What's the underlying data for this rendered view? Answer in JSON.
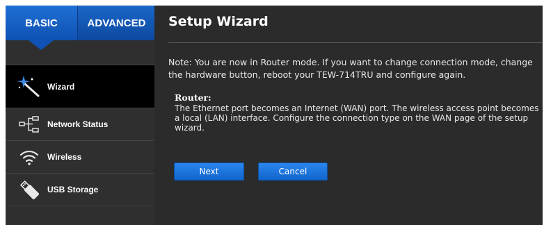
{
  "tabs": {
    "basic": "BASIC",
    "advanced": "ADVANCED"
  },
  "sidebar": {
    "items": [
      {
        "label": "Wizard",
        "icon": "wand-icon"
      },
      {
        "label": "Network Status",
        "icon": "network-icon"
      },
      {
        "label": "Wireless",
        "icon": "wifi-icon"
      },
      {
        "label": "USB Storage",
        "icon": "usb-icon"
      }
    ]
  },
  "main": {
    "title": "Setup Wizard",
    "note": "Note: You are now in Router mode. If you want to change connection mode, change the hardware button, reboot your TEW-714TRU and configure again.",
    "router_title": "Router:",
    "router_text": "The Ethernet port becomes an Internet (WAN) port. The wireless access point becomes a local (LAN) interface. Configure the connection type on the WAN page of the setup wizard.",
    "buttons": {
      "next": "Next",
      "cancel": "Cancel"
    }
  },
  "colors": {
    "tab_blue": "#0f52b3",
    "background": "#2b2b2b",
    "active_item": "#000000",
    "button_blue": "#1a72dd"
  }
}
